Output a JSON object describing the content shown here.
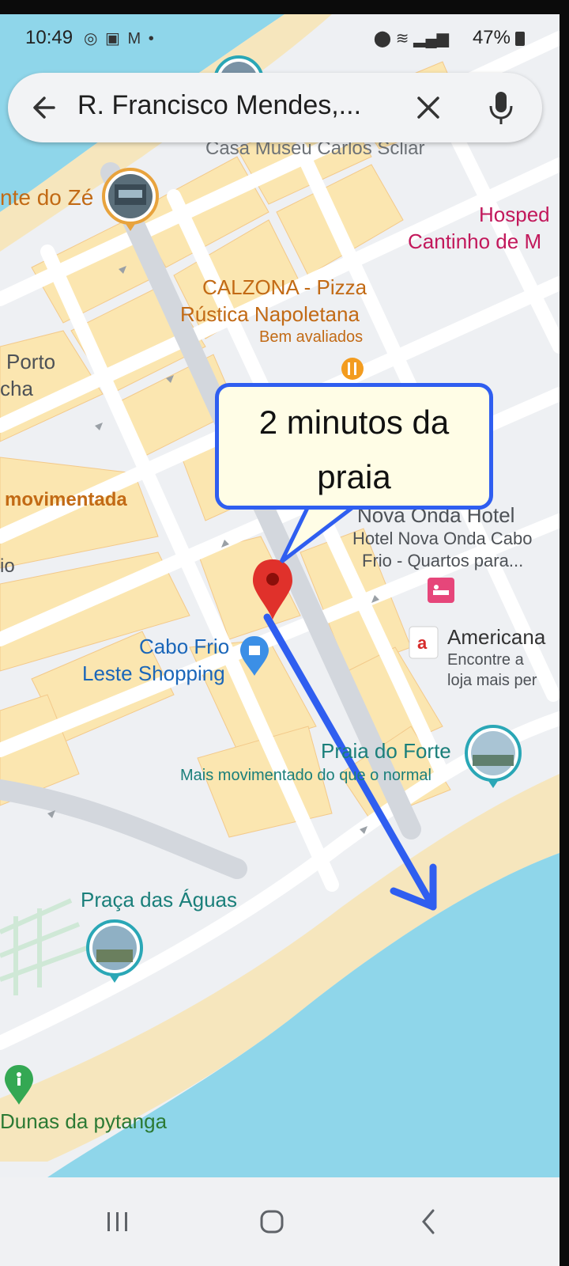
{
  "status_bar": {
    "time": "10:49",
    "left_icons": [
      "whatsapp-icon",
      "gallery-icon",
      "gmail-icon",
      "dot-icon"
    ],
    "right_icons": [
      "location-icon",
      "wifi-icon",
      "signal-icon"
    ],
    "battery": "47%"
  },
  "search": {
    "query": "R. Francisco Mendes,..."
  },
  "map": {
    "places": {
      "museum_partial": "Casa Museu Carlos Scliar",
      "restaurant_ze": "nte do Zé",
      "hospedaria_line1": "Hosped",
      "hospedaria_line2": "Cantinho de M",
      "calzona_line1": "CALZONA - Pizza",
      "calzona_line2": "Rústica Napoletana",
      "calzona_badge": "Bem avaliados",
      "porto_line1": "Porto",
      "porto_line2": "cha",
      "movimentada": "movimentada",
      "left_io": "io",
      "hotel_title": "Nova Onda Hotel",
      "hotel_line1": "Hotel Nova Onda Cabo",
      "hotel_line2": "Frio - Quartos para...",
      "americanas_title": "Americana",
      "americanas_line1": "Encontre a",
      "americanas_line2": "loja mais per",
      "shopping_line1": "Cabo Frio",
      "shopping_line2": "Leste Shopping",
      "praia_title": "Praia do Forte",
      "praia_sub": "Mais movimentado do que o normal",
      "praca": "Praça das Águas",
      "dunas": "Dunas da pytanga"
    },
    "callout_line1": "2 minutos da",
    "callout_line2": "praia",
    "colors": {
      "water": "#8fd6ea",
      "sand": "#f6e6bd",
      "block": "#fbe6b0",
      "road": "#ffffff",
      "arrow": "#2f5ef0",
      "pin": "#e0312b"
    }
  },
  "nav_bar": {
    "recents_icon": "recents-icon",
    "home_icon": "home-icon",
    "back_icon": "back-icon"
  }
}
